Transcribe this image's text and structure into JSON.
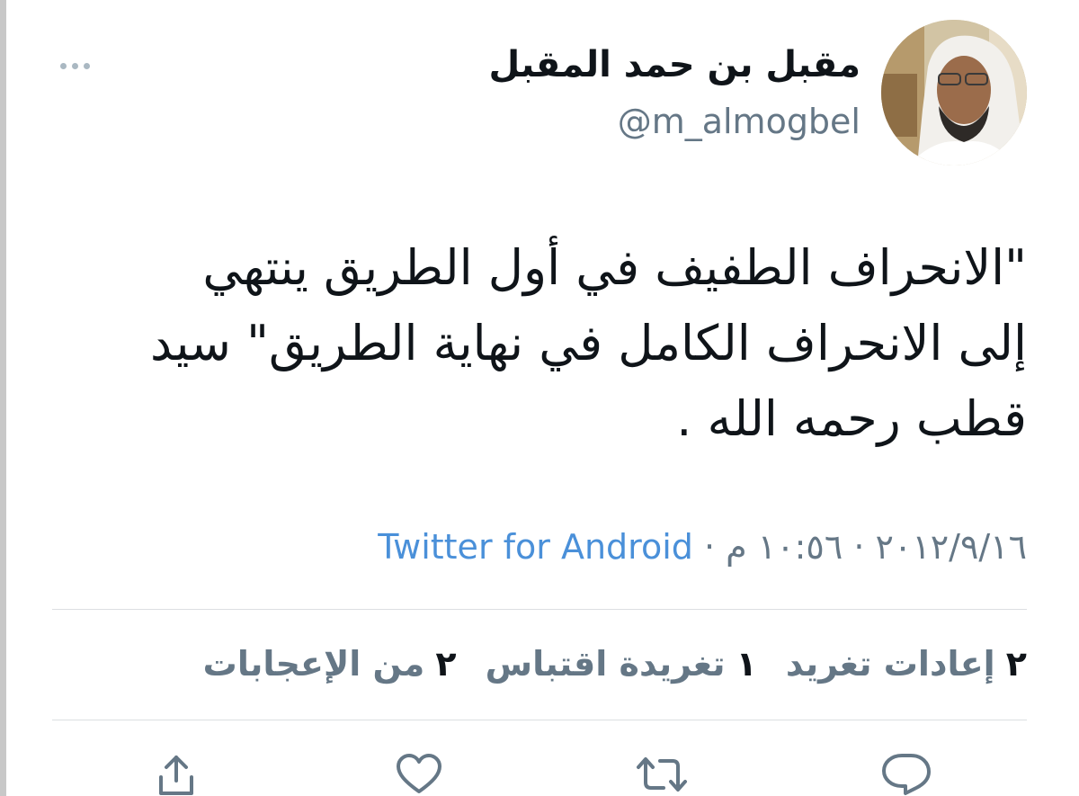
{
  "user": {
    "name": "مقبل بن حمد المقبل",
    "handle": "@m_almogbel"
  },
  "tweet": {
    "lines": [
      "\"الانحراف الطفيف في أول الطريق ينتهي",
      "إلى الانحراف الكامل في نهاية الطريق\" سيد",
      "قطب رحمه الله ."
    ]
  },
  "meta": {
    "date": "٢٠١٢/٩/١٦",
    "separator": "·",
    "time": "١٠:٥٦ م",
    "source": "Twitter for Android"
  },
  "stats": {
    "retweets": {
      "count": "٢",
      "label": "إعادات تغريد"
    },
    "quotes": {
      "count": "١",
      "label": "تغريدة اقتباس"
    },
    "likes": {
      "count": "٢",
      "label": "من الإعجابات"
    }
  },
  "actions": [
    "reply-icon",
    "retweet-icon",
    "like-icon",
    "share-icon"
  ],
  "colors": {
    "text": "#0f1419",
    "secondary": "#657786",
    "link": "#4a90d9",
    "divider": "#dcdfe2"
  }
}
